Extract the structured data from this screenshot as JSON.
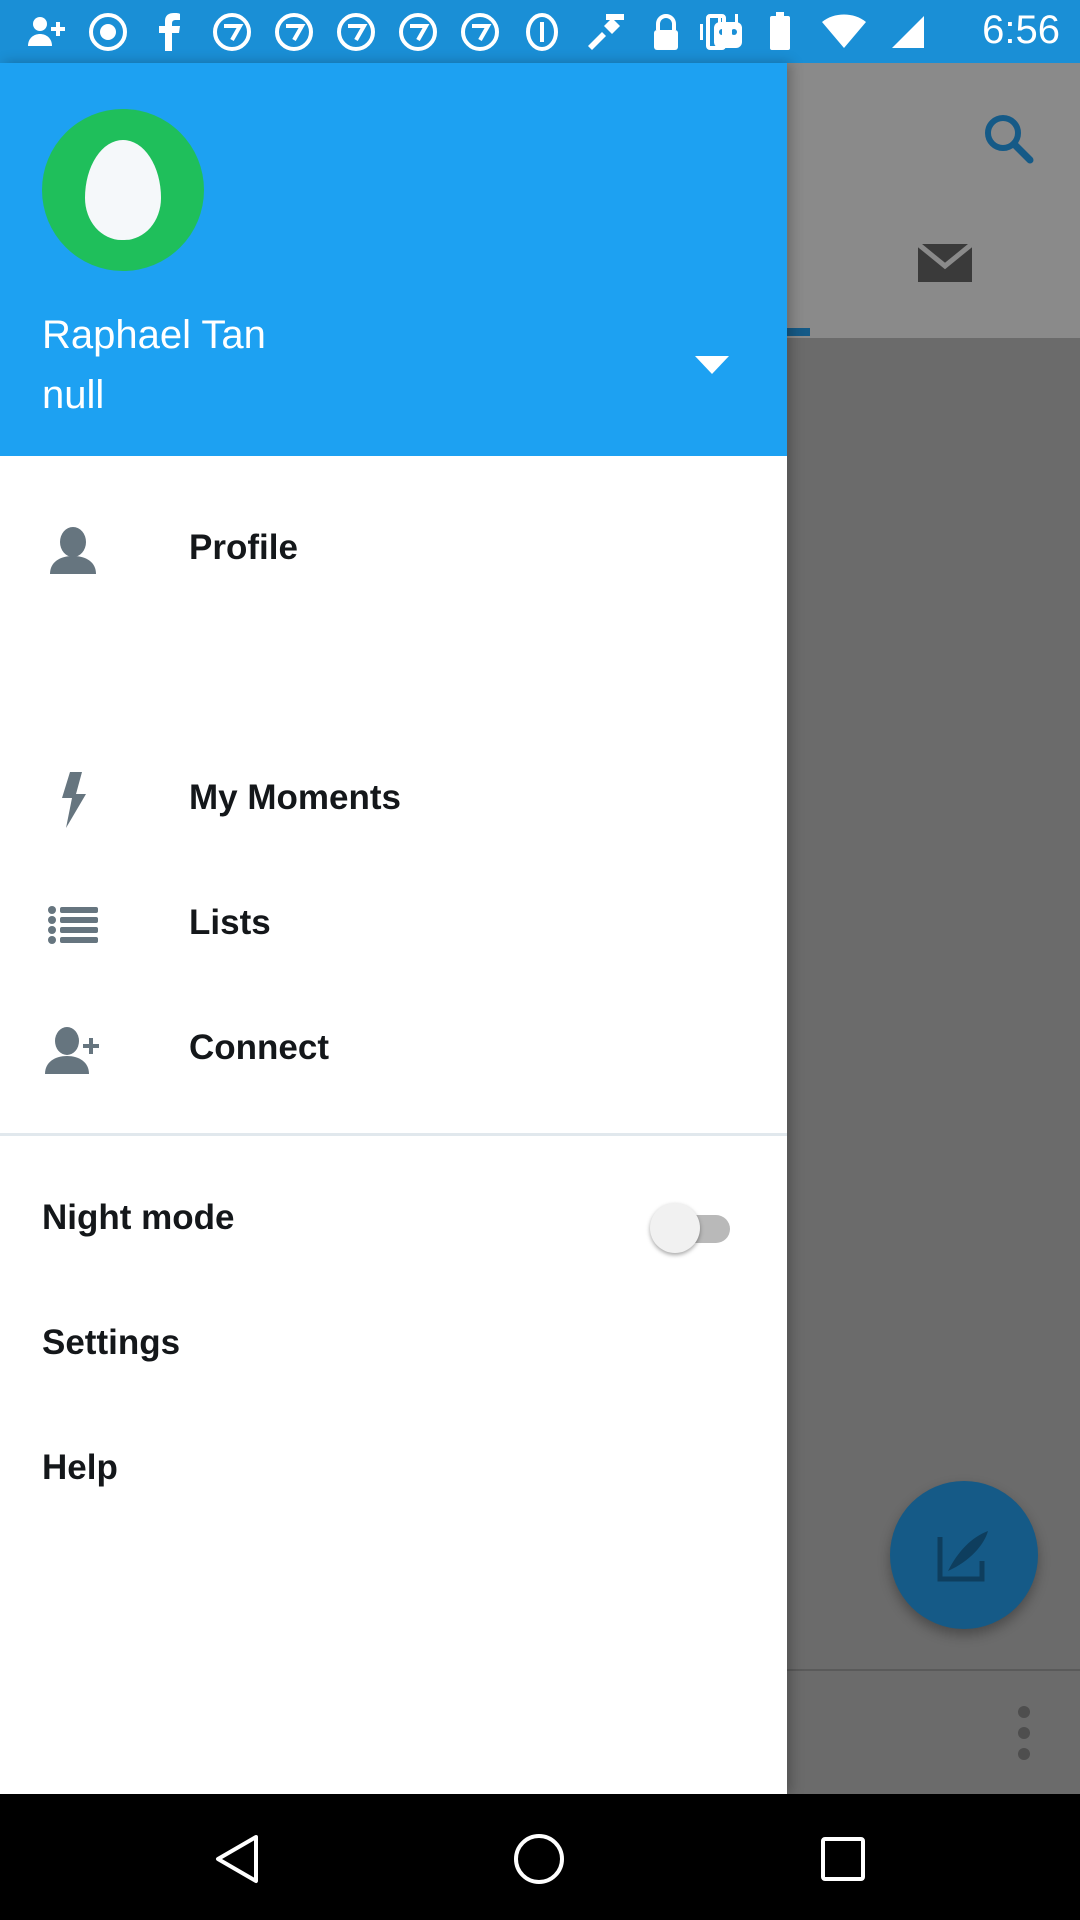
{
  "status_bar": {
    "time": "6:56",
    "left_icons": [
      "add-contact-icon",
      "abc7-icon",
      "facebook-icon",
      "abc7-icon",
      "abc7-icon",
      "abc7-icon",
      "abc7-icon",
      "abc7-icon",
      "info-icon",
      "fake-gps-icon",
      "lock-icon",
      "android-icon"
    ],
    "right_icons": [
      "vibrate-icon",
      "battery-icon",
      "wifi-icon",
      "signal-icon"
    ]
  },
  "drawer": {
    "header": {
      "name": "Raphael Tan",
      "handle": "null",
      "avatar_color": "#1fbf5b",
      "background_color": "#1da1f2"
    },
    "items": [
      {
        "label": "Profile",
        "icon": "person-icon"
      },
      {
        "label": "My Moments",
        "icon": "lightning-icon"
      },
      {
        "label": "Lists",
        "icon": "list-icon"
      },
      {
        "label": "Connect",
        "icon": "add-person-icon"
      }
    ],
    "night_mode": {
      "label": "Night mode",
      "enabled": false
    },
    "settings_label": "Settings",
    "help_label": "Help"
  },
  "background_app": {
    "icons": [
      "search-icon",
      "mail-icon",
      "compose-icon",
      "more-icon"
    ]
  },
  "nav_bar": {
    "buttons": [
      "back-icon",
      "home-icon",
      "recents-icon"
    ]
  }
}
